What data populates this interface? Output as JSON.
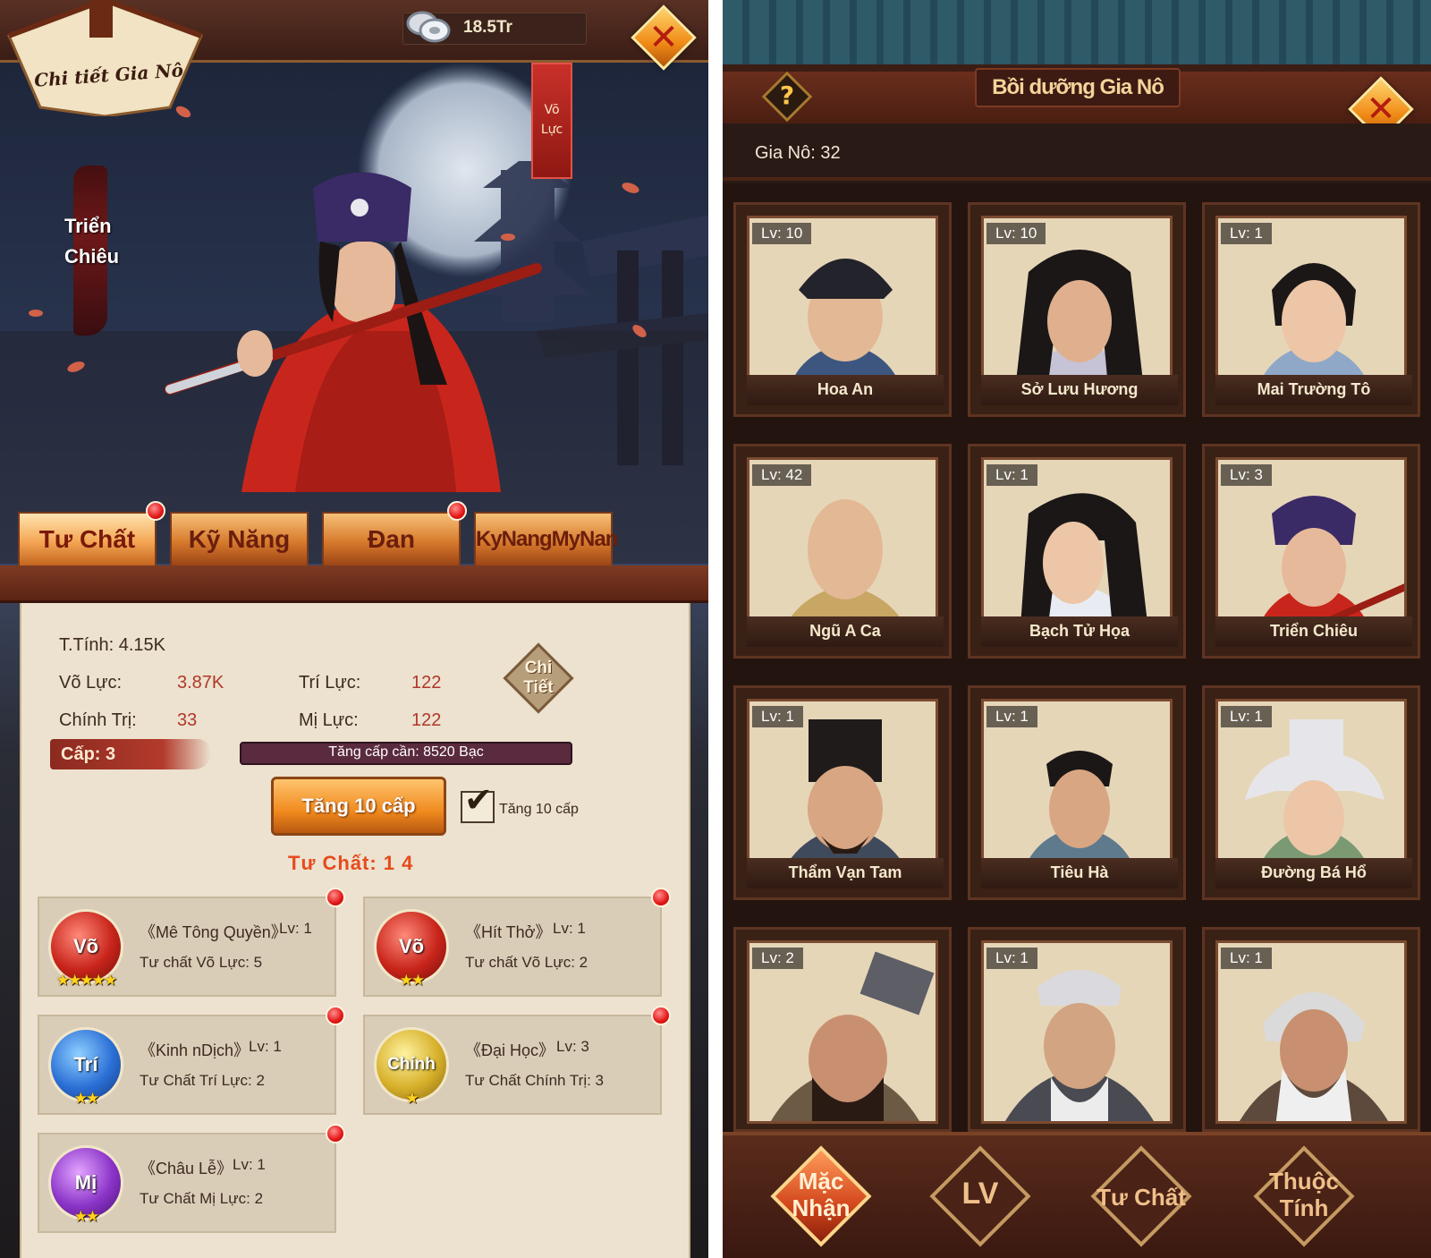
{
  "left": {
    "window_title": "Chi tiết Gia Nô",
    "currency": {
      "icon": "silver-coins-icon",
      "value": "18.5Tr"
    },
    "close_icon": "close-x-icon",
    "side_tag": {
      "line1": "Võ",
      "line2": "Lực"
    },
    "character_name": {
      "line1": "Triển",
      "line2": "Chiêu"
    },
    "tabs": [
      {
        "label": "Tư Chất",
        "active": true,
        "notify": true
      },
      {
        "label": "Kỹ Năng",
        "active": false,
        "notify": false
      },
      {
        "label": "Đan",
        "active": false,
        "notify": true
      },
      {
        "label": "KyNangMyNan",
        "active": false,
        "notify": false
      }
    ],
    "stats": {
      "total_label": "T.Tính: 4.15K",
      "vo_luc_label": "Võ Lực:",
      "vo_luc_value": "3.87K",
      "tri_luc_label": "Trí Lực:",
      "tri_luc_value": "122",
      "chinh_tri_label": "Chính Trị:",
      "chinh_tri_value": "33",
      "mi_luc_label": "Mị Lực:",
      "mi_luc_value": "122",
      "detail_button": {
        "line1": "Chi",
        "line2": "Tiết"
      }
    },
    "level_label": "Cấp: 3",
    "upgrade_cost": "Tăng cấp cần: 8520 Bạc",
    "upgrade_button": "Tăng 10 cấp",
    "checkbox": {
      "checked": true,
      "label": "Tăng 10 cấp"
    },
    "aptitude_line": "Tư Chất:  1 4",
    "skills": [
      {
        "medal": "Võ",
        "color": "red",
        "stars": "★★★★★",
        "name": "《Mê Tông Quyền》",
        "lv": "Lv: 1",
        "desc": "Tư chất Võ Lực:  5",
        "notify": true
      },
      {
        "medal": "Võ",
        "color": "red",
        "stars": "★★",
        "name": "《Hít Thở》",
        "lv": "Lv: 1",
        "desc": "Tư chất Võ Lực:  2",
        "notify": true
      },
      {
        "medal": "Trí",
        "color": "blue",
        "stars": "★★",
        "name": "《Kinh nDịch》",
        "lv": "Lv: 1",
        "desc": "Tư Chất Trí Lực:  2",
        "notify": true
      },
      {
        "medal": "Chính",
        "color": "gold",
        "stars": "★",
        "name": "《Đại Học》",
        "lv": "Lv: 3",
        "desc": "Tư Chất Chính Trị:  3",
        "notify": true
      },
      {
        "medal": "Mị",
        "color": "purple",
        "stars": "★★",
        "name": "《Châu Lễ》",
        "lv": "Lv: 1",
        "desc": "Tư Chất Mị Lực:  2",
        "notify": true
      }
    ]
  },
  "right": {
    "window_title": "Bồi dưỡng Gia Nô",
    "help_icon": "question-icon",
    "count_label": "Gia Nô: 32",
    "cards": [
      {
        "lv": "Lv: 10",
        "name": "Hoa An"
      },
      {
        "lv": "Lv: 10",
        "name": "Sở Lưu Hương"
      },
      {
        "lv": "Lv: 1",
        "name": "Mai Trường Tô"
      },
      {
        "lv": "Lv: 42",
        "name": "Ngũ A Ca",
        "notify": true
      },
      {
        "lv": "Lv: 1",
        "name": "Bạch Tử Họa"
      },
      {
        "lv": "Lv: 3",
        "name": "Triển Chiêu"
      },
      {
        "lv": "Lv: 1",
        "name": "Thẩm Vạn Tam"
      },
      {
        "lv": "Lv: 1",
        "name": "Tiêu Hà"
      },
      {
        "lv": "Lv: 1",
        "name": "Đường Bá Hổ"
      },
      {
        "lv": "Lv: 2",
        "name": ""
      },
      {
        "lv": "Lv: 1",
        "name": ""
      },
      {
        "lv": "Lv: 1",
        "name": ""
      }
    ],
    "sort_buttons": [
      {
        "line1": "Mặc",
        "line2": "Nhận",
        "active": true
      },
      {
        "line1": "LV",
        "line2": "",
        "active": false
      },
      {
        "line1": "Tư Chất",
        "line2": "",
        "active": false
      },
      {
        "line1": "Thuộc",
        "line2": "Tính",
        "active": false
      }
    ]
  }
}
